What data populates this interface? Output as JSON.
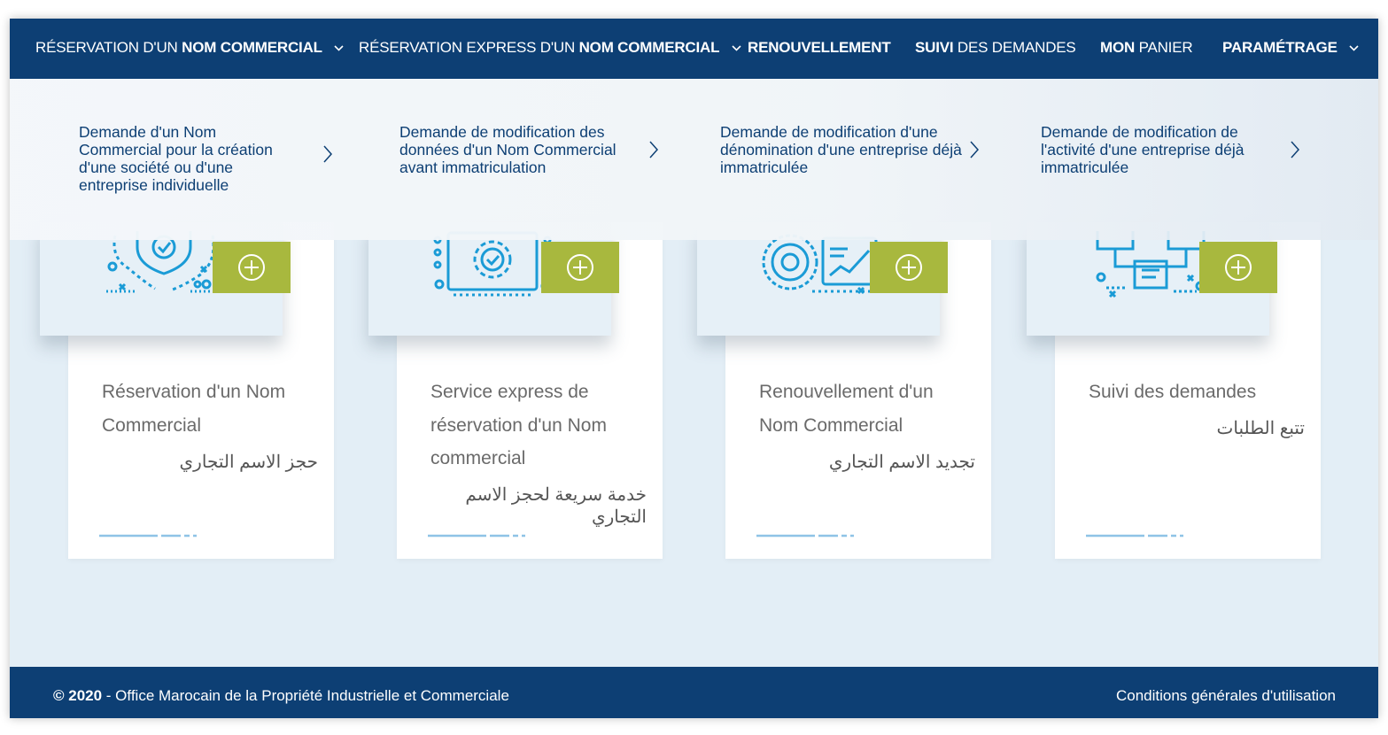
{
  "nav": {
    "items": [
      {
        "pre": "RÉSERVATION D'UN ",
        "bold": "NOM COMMERCIAL",
        "post": "",
        "dropdown": true
      },
      {
        "pre": "RÉSERVATION EXPRESS D'UN ",
        "bold": "NOM COMMERCIAL",
        "post": "",
        "dropdown": true
      },
      {
        "pre": "",
        "bold": "RENOUVELLEMENT",
        "post": "",
        "dropdown": false
      },
      {
        "pre": "",
        "bold": "SUIVI",
        "post": " DES DEMANDES",
        "dropdown": false
      },
      {
        "pre": "",
        "bold": "MON",
        "post": " PANIER",
        "dropdown": false
      },
      {
        "pre": "",
        "bold": "PARAMÉTRAGE",
        "post": "",
        "dropdown": true
      }
    ]
  },
  "dropdown": {
    "items": [
      {
        "label": "Demande d'un Nom Commercial pour la création d'une société ou d'une entreprise individuelle"
      },
      {
        "label": "Demande de modification des données d'un Nom Commercial avant immatriculation"
      },
      {
        "label": "Demande de modification d'une dénomination d'une entreprise déjà immatriculée"
      },
      {
        "label": "Demande de modification de l'activité d'une entreprise déjà immatriculée"
      }
    ]
  },
  "cards": [
    {
      "title": "Réservation d'un Nom Commercial",
      "arabic": "حجز الاسم التجاري",
      "icon": "shield-check-illustration-icon"
    },
    {
      "title": "Service express de réservation d'un Nom commercial",
      "arabic": "خدمة سريعة لحجز الاسم التجاري",
      "icon": "screen-refresh-check-illustration-icon"
    },
    {
      "title": "Renouvellement d'un Nom Commercial",
      "arabic": "تجديد الاسم التجاري",
      "icon": "gear-chart-illustration-icon"
    },
    {
      "title": "Suivi des demandes",
      "arabic": "تتبع الطلبات",
      "icon": "flow-diagram-illustration-icon"
    }
  ],
  "footer": {
    "copyright_year": "© 2020",
    "copyright_text": " - Office Marocain de la Propriété Industrielle et Commerciale",
    "terms": "Conditions générales d'utilisation"
  },
  "colors": {
    "nav_bg": "#0d3f74",
    "accent_green": "#a8b83e",
    "illustration_blue": "#1a9bd6",
    "page_bg": "#e3eef6"
  }
}
